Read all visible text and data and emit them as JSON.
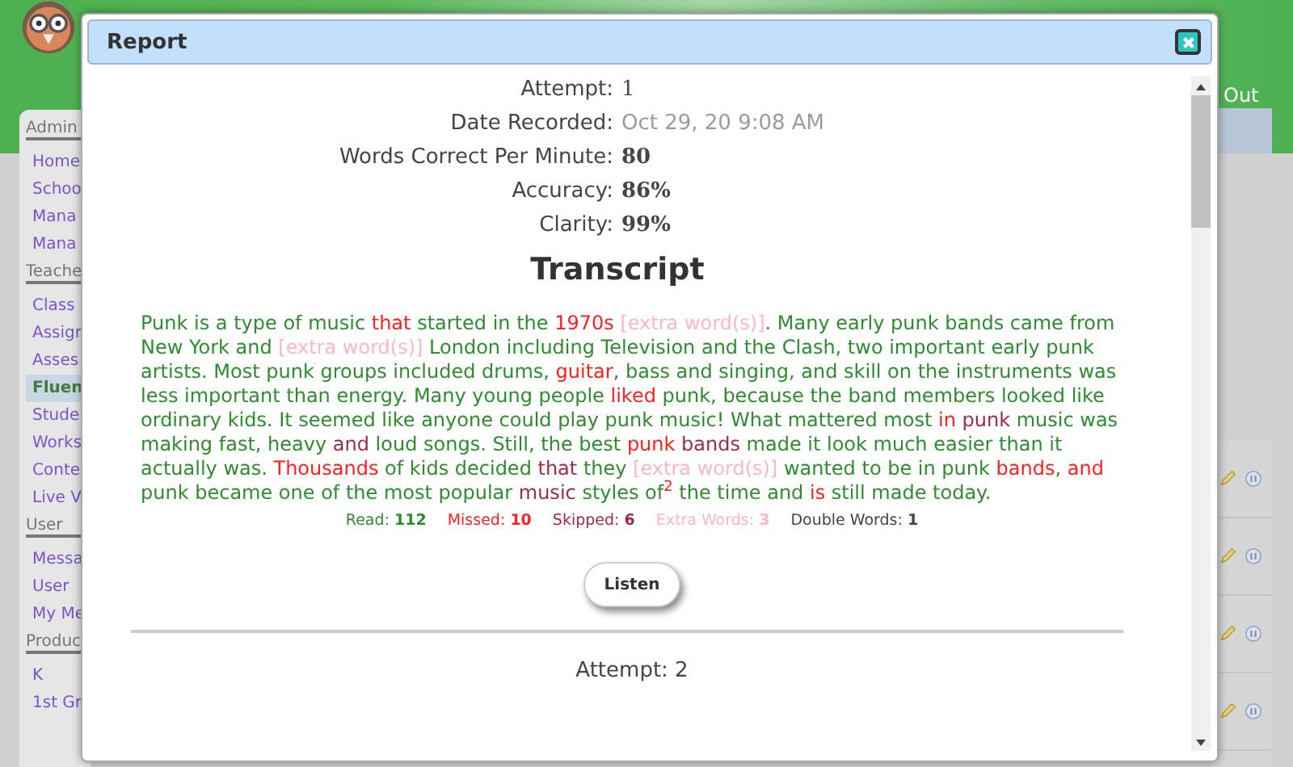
{
  "page": {
    "logout": "Out",
    "sidebar": [
      {
        "heading": "Admin",
        "items": [
          {
            "label": "Home",
            "selected": false
          },
          {
            "label": "Schoo",
            "selected": false
          },
          {
            "label": "Mana",
            "selected": false
          },
          {
            "label": "Mana",
            "selected": false
          }
        ]
      },
      {
        "heading": "Teache",
        "items": [
          {
            "label": "Class",
            "selected": false
          },
          {
            "label": "Assigr",
            "selected": false
          },
          {
            "label": "Asses",
            "selected": false
          },
          {
            "label": "Fluen",
            "selected": true
          },
          {
            "label": "Stude",
            "selected": false
          },
          {
            "label": "Works",
            "selected": false
          },
          {
            "label": "Conte",
            "selected": false
          },
          {
            "label": "Live V",
            "selected": false
          }
        ]
      },
      {
        "heading": "User",
        "items": [
          {
            "label": "Messa",
            "selected": false
          },
          {
            "label": "User",
            "selected": false
          },
          {
            "label": "My Me",
            "selected": false
          }
        ]
      },
      {
        "heading": "Produc",
        "items": [
          {
            "label": "K",
            "selected": false
          },
          {
            "label": "1st Gr",
            "selected": false
          }
        ]
      }
    ]
  },
  "dialog": {
    "title": "Report",
    "fields": [
      {
        "label": "Attempt:",
        "value": "1",
        "kind": "plain"
      },
      {
        "label": "Date Recorded:",
        "value": "Oct 29, 20 9:08 AM",
        "kind": "blurred"
      },
      {
        "label": "Words Correct Per Minute:",
        "value": "80",
        "kind": "bold"
      },
      {
        "label": "Accuracy:",
        "value": "86%",
        "kind": "bold"
      },
      {
        "label": "Clarity:",
        "value": "99%",
        "kind": "bold"
      }
    ],
    "heading": "Transcript",
    "transcript": [
      {
        "text": "Punk is a type of music ",
        "kind": "read"
      },
      {
        "text": "that",
        "kind": "missed"
      },
      {
        "text": " started in the ",
        "kind": "read"
      },
      {
        "text": "1970s ",
        "kind": "missed"
      },
      {
        "text": "[extra word(s)]",
        "kind": "extra"
      },
      {
        "text": ". Many early punk bands came from New York and ",
        "kind": "read"
      },
      {
        "text": "[extra word(s)]",
        "kind": "extra"
      },
      {
        "text": " London including Television and the Clash, two important early punk artists. Most punk groups included drums, ",
        "kind": "read"
      },
      {
        "text": "guitar",
        "kind": "missed"
      },
      {
        "text": ", bass and singing, and skill on the instruments was less important than energy. Many young people ",
        "kind": "read"
      },
      {
        "text": "liked",
        "kind": "missed"
      },
      {
        "text": " punk, because the band members looked like ordinary kids. It seemed like anyone could play punk music! What mattered most ",
        "kind": "read"
      },
      {
        "text": "in ",
        "kind": "missed"
      },
      {
        "text": "punk",
        "kind": "skipped"
      },
      {
        "text": " music was making fast, heavy ",
        "kind": "read"
      },
      {
        "text": "and",
        "kind": "skipped"
      },
      {
        "text": " loud songs. Still, the best ",
        "kind": "read"
      },
      {
        "text": "punk ",
        "kind": "missed"
      },
      {
        "text": "bands",
        "kind": "skipped"
      },
      {
        "text": " made it look much easier than it actually was. ",
        "kind": "read"
      },
      {
        "text": "Thousands",
        "kind": "missed"
      },
      {
        "text": " of kids decided ",
        "kind": "read"
      },
      {
        "text": "that",
        "kind": "skipped"
      },
      {
        "text": " they ",
        "kind": "read"
      },
      {
        "text": "[extra word(s)]",
        "kind": "extra"
      },
      {
        "text": " wanted to be in punk ",
        "kind": "read"
      },
      {
        "text": "bands",
        "kind": "missed"
      },
      {
        "text": ", ",
        "kind": "read"
      },
      {
        "text": "and",
        "kind": "missed"
      },
      {
        "text": " punk became one of the most popular ",
        "kind": "read"
      },
      {
        "text": "music",
        "kind": "skipped"
      },
      {
        "text": " styles of",
        "kind": "read"
      },
      {
        "text": "2",
        "kind": "double"
      },
      {
        "text": " the time and ",
        "kind": "read"
      },
      {
        "text": "is",
        "kind": "missed"
      },
      {
        "text": " still made today.",
        "kind": "read"
      }
    ],
    "stats": [
      {
        "label": "Read:",
        "value": "112",
        "kind": "read"
      },
      {
        "label": "Missed:",
        "value": "10",
        "kind": "missed"
      },
      {
        "label": "Skipped:",
        "value": "6",
        "kind": "skipped"
      },
      {
        "label": "Extra Words:",
        "value": "3",
        "kind": "extra"
      },
      {
        "label": "Double Words:",
        "value": "1",
        "kind": "double"
      }
    ],
    "button": "Listen",
    "next_attempt": "Attempt: 2"
  }
}
